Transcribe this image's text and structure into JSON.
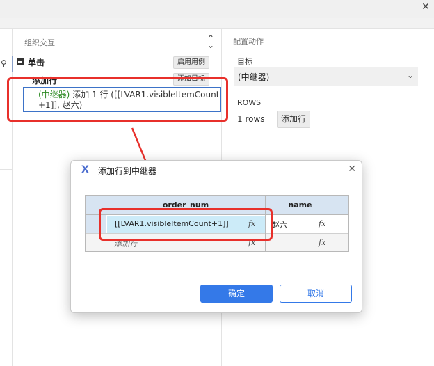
{
  "window": {
    "close_icon": "close-icon"
  },
  "middle_panel": {
    "title": "组织交互",
    "event_label": "单击",
    "enable_usecase_label": "启用用例",
    "action_label": "添加行",
    "add_target_label": "添加目标",
    "action_target": "(中继器)",
    "action_text_line1": "添加 1 行 ([[LVAR1.visibleItemCount",
    "action_text_line2": "+1]], 赵六)"
  },
  "right_panel": {
    "title": "配置动作",
    "target_label": "目标",
    "target_value": "(中继器)",
    "rows_label": "ROWS",
    "rows_value": "1 rows",
    "add_row_button": "添加行"
  },
  "dialog": {
    "title": "添加行到中继器",
    "columns": [
      "order_num",
      "name"
    ],
    "rows": [
      {
        "order_num": "[[LVAR1.visibleItemCount+1]]",
        "name": "赵六"
      },
      {
        "order_num": "添加行",
        "name": ""
      }
    ],
    "fx_label": "fx",
    "ok_label": "确定",
    "cancel_label": "取消"
  },
  "colors": {
    "accent": "#3479e8",
    "highlight_red": "#e8302b",
    "target_green": "#2e8a24",
    "header_blue": "#d7e4f2",
    "selected_cell": "#ccebf8"
  }
}
